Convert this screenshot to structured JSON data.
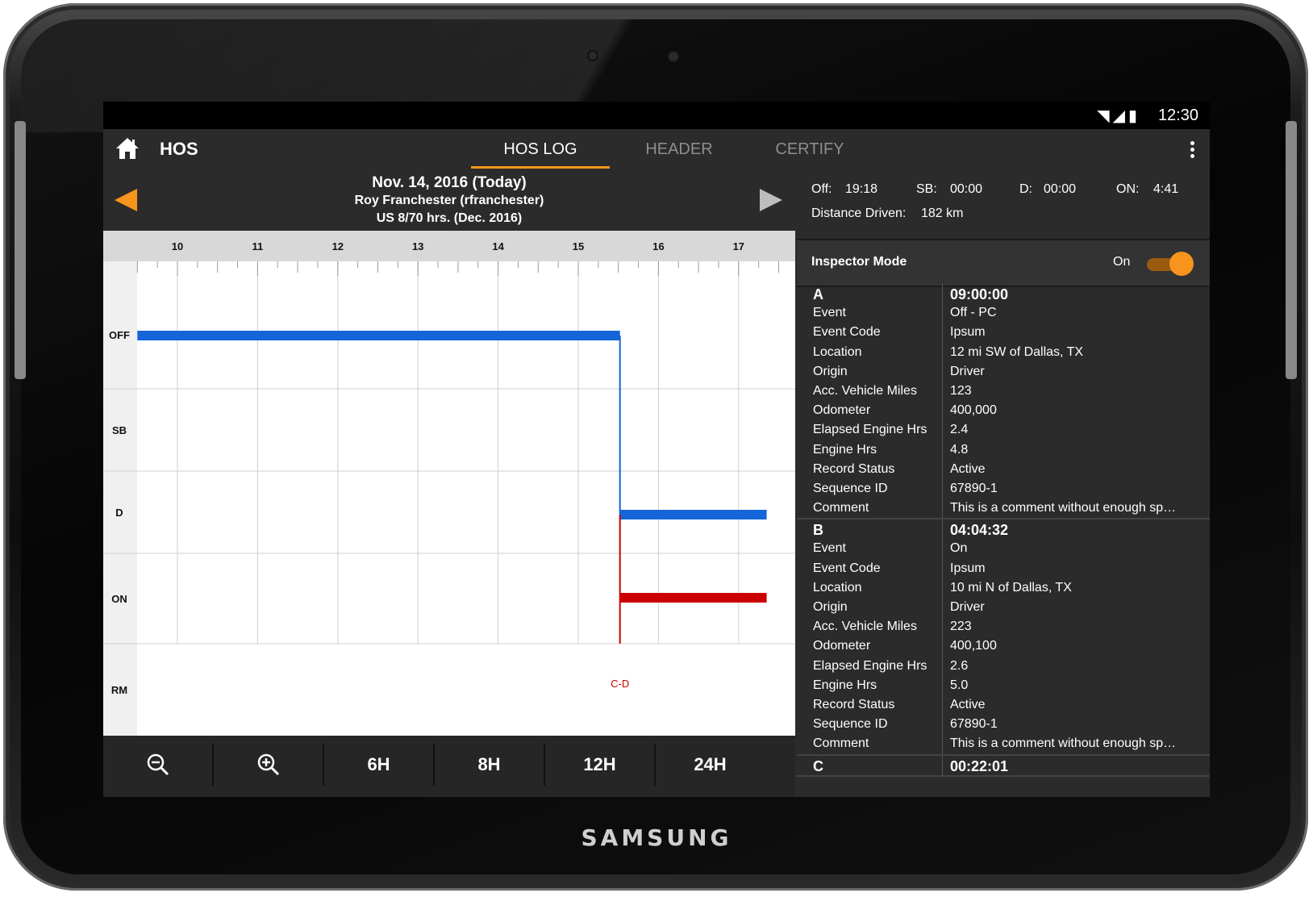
{
  "device": {
    "brand": "SAMSUNG"
  },
  "statusbar": {
    "time": "12:30",
    "icons": [
      "wifi-icon",
      "signal-icon",
      "battery-icon"
    ]
  },
  "appbar": {
    "title": "HOS",
    "tabs": [
      {
        "label": "HOS LOG",
        "active": true
      },
      {
        "label": "HEADER",
        "active": false
      },
      {
        "label": "CERTIFY",
        "active": false
      }
    ]
  },
  "datebar": {
    "date": "Nov. 14, 2016 (Today)",
    "driver": "Roy Franchester (rfranchester)",
    "ruleset": "US 8/70 hrs. (Dec. 2016)"
  },
  "chart_data": {
    "type": "line",
    "x_ticks": [
      "10",
      "11",
      "12",
      "13",
      "14",
      "15",
      "16",
      "17"
    ],
    "status_rows": [
      "OFF",
      "SB",
      "D",
      "ON",
      "RM"
    ],
    "segments": [
      {
        "status": "OFF",
        "start_hour": 9.5,
        "end_hour": 15.52,
        "color": "#1565d8"
      },
      {
        "status": "D",
        "start_hour": 15.52,
        "end_hour": 17.35,
        "color": "#1565d8"
      },
      {
        "status": "ON",
        "start_hour": 15.52,
        "end_hour": 17.35,
        "color": "#cc0000"
      }
    ],
    "annotations": [
      {
        "row": "RM",
        "hour": 15.52,
        "text": "C-D",
        "color": "#cc0000"
      }
    ]
  },
  "toolbar": {
    "buttons": [
      {
        "label": "",
        "icon": "zoom-out-icon"
      },
      {
        "label": "",
        "icon": "zoom-in-icon"
      },
      {
        "label": "6H"
      },
      {
        "label": "8H"
      },
      {
        "label": "12H"
      },
      {
        "label": "24H"
      }
    ]
  },
  "summary": {
    "off_label": "Off:",
    "off_value": "19:18",
    "sb_label": "SB:",
    "sb_value": "00:00",
    "d_label": "D:",
    "d_value": "00:00",
    "on_label": "ON:",
    "on_value": "4:41",
    "distance_label": "Distance Driven:",
    "distance_value": "182 km"
  },
  "inspector": {
    "label": "Inspector Mode",
    "state": "On"
  },
  "events": [
    {
      "id": "A",
      "time": "09:00:00",
      "fields": [
        [
          "Event",
          "Off - PC"
        ],
        [
          "Event Code",
          "Ipsum"
        ],
        [
          "Location",
          "12 mi SW of Dallas, TX"
        ],
        [
          "Origin",
          "Driver"
        ],
        [
          "Acc. Vehicle Miles",
          "123"
        ],
        [
          "Odometer",
          "400,000"
        ],
        [
          "Elapsed Engine Hrs",
          "2.4"
        ],
        [
          "Engine Hrs",
          "4.8"
        ],
        [
          "Record Status",
          "Active"
        ],
        [
          "Sequence ID",
          "67890-1"
        ],
        [
          "Comment",
          "This is a comment without enough sp…"
        ]
      ]
    },
    {
      "id": "B",
      "time": "04:04:32",
      "fields": [
        [
          "Event",
          "On"
        ],
        [
          "Event Code",
          "Ipsum"
        ],
        [
          "Location",
          "10 mi N of Dallas, TX"
        ],
        [
          "Origin",
          "Driver"
        ],
        [
          "Acc. Vehicle Miles",
          "223"
        ],
        [
          "Odometer",
          "400,100"
        ],
        [
          "Elapsed Engine Hrs",
          "2.6"
        ],
        [
          "Engine Hrs",
          "5.0"
        ],
        [
          "Record Status",
          "Active"
        ],
        [
          "Sequence ID",
          "67890-1"
        ],
        [
          "Comment",
          "This is a comment without enough sp…"
        ]
      ]
    },
    {
      "id": "C",
      "time": "00:22:01",
      "fields": []
    }
  ]
}
